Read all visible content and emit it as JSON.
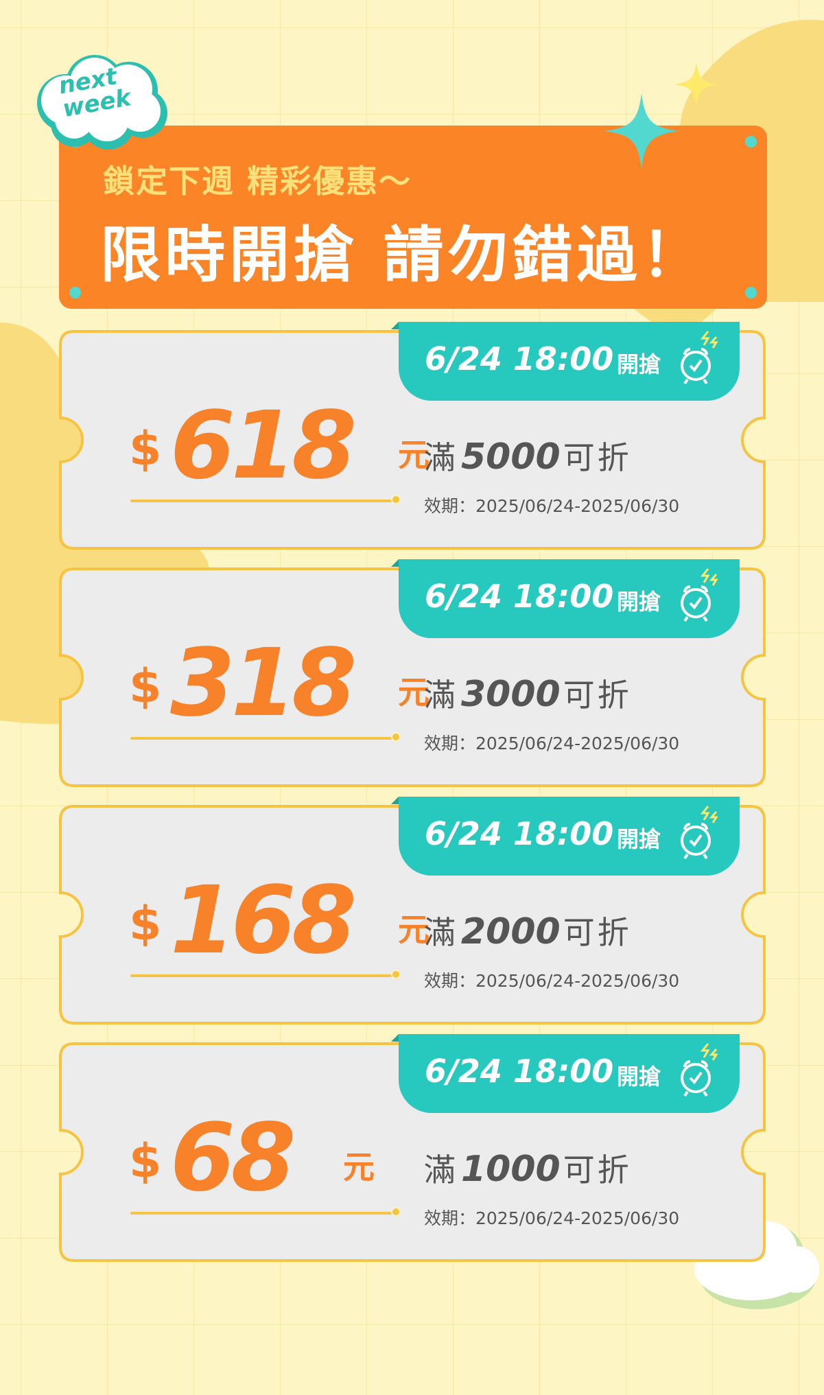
{
  "badge": {
    "line1": "next",
    "line2": "week"
  },
  "banner": {
    "subtitle": "鎖定下週 精彩優惠～",
    "title": "限時開搶 請勿錯過！"
  },
  "colors": {
    "background": "#fdf6c4",
    "banner": "#fb8426",
    "accent_teal": "#27c8bd",
    "price_orange": "#f7822a",
    "coupon_fill": "#ececec",
    "coupon_border": "#f6c442"
  },
  "icons": {
    "clock": "alarm-clock-icon",
    "sparkle": "sparkle-star-icon",
    "cloud": "cloud-icon"
  },
  "coupons": [
    {
      "open_time": "6/24 18:00",
      "open_label": "開搶",
      "currency": "$",
      "amount": "618",
      "unit": "元",
      "cond_prefix": "滿",
      "threshold": "5000",
      "cond_suffix": "可折",
      "validity": "效期：2025/06/24-2025/06/30"
    },
    {
      "open_time": "6/24 18:00",
      "open_label": "開搶",
      "currency": "$",
      "amount": "318",
      "unit": "元",
      "cond_prefix": "滿",
      "threshold": "3000",
      "cond_suffix": "可折",
      "validity": "效期：2025/06/24-2025/06/30"
    },
    {
      "open_time": "6/24 18:00",
      "open_label": "開搶",
      "currency": "$",
      "amount": "168",
      "unit": "元",
      "cond_prefix": "滿",
      "threshold": "2000",
      "cond_suffix": "可折",
      "validity": "效期：2025/06/24-2025/06/30"
    },
    {
      "open_time": "6/24 18:00",
      "open_label": "開搶",
      "currency": "$",
      "amount": "68",
      "unit": "元",
      "cond_prefix": "滿",
      "threshold": "1000",
      "cond_suffix": "可折",
      "validity": "效期：2025/06/24-2025/06/30"
    }
  ]
}
